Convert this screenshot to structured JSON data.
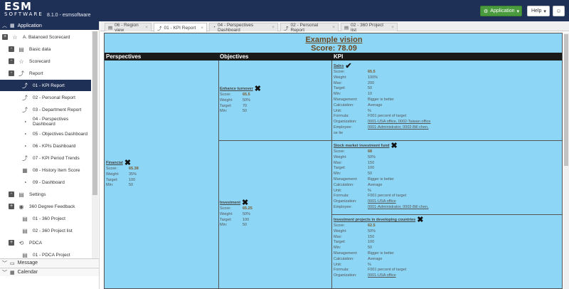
{
  "app": {
    "logo_main": "ESM",
    "logo_sub": "SOFTWARE",
    "version": "8.1.0 - esmsoftware"
  },
  "header": {
    "application_label": "Application",
    "help_label": "Help",
    "user_icon": "user-icon",
    "accent": "#4a9b3e",
    "bar_color": "#1f3057"
  },
  "sidebar": {
    "title": "Application",
    "items": [
      {
        "label": "A. Balanced Scorecard",
        "icon": "star-icon",
        "toggle": "+"
      },
      {
        "label": "Basic data",
        "icon": "document-icon",
        "toggle": "-"
      },
      {
        "label": "Scorecard",
        "icon": "star-icon",
        "toggle": "-"
      },
      {
        "label": "Report",
        "icon": "trend-icon",
        "toggle": "-"
      },
      {
        "label": "01 - KPI Report",
        "icon": "trend-icon",
        "active": true
      },
      {
        "label": "02 - Personal Report",
        "icon": "trend-icon"
      },
      {
        "label": "03 - Department Report",
        "icon": "trend-icon"
      },
      {
        "label": "04 - Perspectives Dashboard",
        "icon": "pie-icon"
      },
      {
        "label": "05 - Objectives Dashboard",
        "icon": "pie-icon"
      },
      {
        "label": "06 - KPIs Dashboard",
        "icon": "pie-icon"
      },
      {
        "label": "07 - KPI Period Trends",
        "icon": "trend-icon"
      },
      {
        "label": "08 - History Item Score",
        "icon": "calendar-icon"
      },
      {
        "label": "09 - Dashboard",
        "icon": "pie-icon"
      },
      {
        "label": "Settings",
        "icon": "document-icon",
        "toggle": "-"
      },
      {
        "label": "360 Degree Feedback",
        "icon": "circle-icon",
        "toggle": "+"
      },
      {
        "label": "01 - 360 Project",
        "icon": "document-icon"
      },
      {
        "label": "02 - 360 Project list",
        "icon": "document-icon"
      },
      {
        "label": "PDCA",
        "icon": "cycle-icon",
        "toggle": "+"
      },
      {
        "label": "01 - PDCA Project",
        "icon": "document-icon"
      }
    ],
    "accordions": [
      {
        "label": "Message"
      },
      {
        "label": "Calendar"
      }
    ]
  },
  "tabs": [
    {
      "label": "06 - Region view"
    },
    {
      "label": "01 - KPI Report",
      "active": true
    },
    {
      "label": "04 - Perspectives Dashboard"
    },
    {
      "label": "02 - Personal Report"
    },
    {
      "label": "02 - 360 Project list"
    }
  ],
  "report": {
    "vision_title": "Example vision",
    "vision_score": "Score: 78.09",
    "headers": {
      "perspectives": "Perspectives",
      "objectives": "Objectives",
      "kpi": "KPI"
    },
    "bg_color": "#8ed6f6",
    "perspective": {
      "name": "Financial",
      "mark": "✖",
      "fields": [
        {
          "k": "Score:",
          "v": "65.38",
          "bold": true
        },
        {
          "k": "Weight:",
          "v": "35%"
        },
        {
          "k": "Target:",
          "v": "100"
        },
        {
          "k": "Min:",
          "v": "50"
        }
      ]
    },
    "objectives": [
      {
        "name": "Enhance turnover",
        "mark": "✖",
        "fields": [
          {
            "k": "Score:",
            "v": "65.5",
            "bold": true
          },
          {
            "k": "Weight:",
            "v": "50%"
          },
          {
            "k": "Target:",
            "v": "70"
          },
          {
            "k": "Min:",
            "v": "50"
          }
        ]
      },
      {
        "name": "Investment",
        "mark": "✖",
        "fields": [
          {
            "k": "Score:",
            "v": "65.25",
            "bold": true
          },
          {
            "k": "Weight:",
            "v": "50%"
          },
          {
            "k": "Target:",
            "v": "100"
          },
          {
            "k": "Min:",
            "v": "50"
          }
        ]
      }
    ],
    "kpis": [
      {
        "name": "Sales",
        "mark": "✔",
        "fields": [
          {
            "k": "Score:",
            "v": "65.5",
            "bold": true
          },
          {
            "k": "Weight:",
            "v": "100%"
          },
          {
            "k": "Max:",
            "v": "200"
          },
          {
            "k": "Target:",
            "v": "50"
          },
          {
            "k": "Min:",
            "v": "10"
          },
          {
            "k": "Management:",
            "v": "Bigger is better"
          },
          {
            "k": "Calculation:",
            "v": "Average"
          },
          {
            "k": "Unit:",
            "v": "%"
          },
          {
            "k": "Formula:",
            "v": "F001 percent of target"
          },
          {
            "k": "Organization:",
            "v": "0001-USA office,  0002-Taiwan office",
            "link": true
          },
          {
            "k": "Employee:",
            "v": "0001-Administrator,  0002-Bill chen,",
            "link": true
          }
        ],
        "extra": "se tie"
      },
      {
        "name": "Stock market investment fund",
        "mark": "✖",
        "fields": [
          {
            "k": "Score:",
            "v": "68",
            "bold": true
          },
          {
            "k": "Weight:",
            "v": "50%"
          },
          {
            "k": "Max:",
            "v": "150"
          },
          {
            "k": "Target:",
            "v": "100"
          },
          {
            "k": "Min:",
            "v": "50"
          },
          {
            "k": "Management:",
            "v": "Bigger is better"
          },
          {
            "k": "Calculation:",
            "v": "Average"
          },
          {
            "k": "Unit:",
            "v": "%"
          },
          {
            "k": "Formula:",
            "v": "F001 percent of target"
          },
          {
            "k": "Organization:",
            "v": "0001-USA office",
            "link": true
          },
          {
            "k": "Employee:",
            "v": "0001-Administrator,  0002-Bill chen,",
            "link": true
          }
        ]
      },
      {
        "name": "Investment projects in developing countries",
        "mark": "✖",
        "fields": [
          {
            "k": "Score:",
            "v": "62.5",
            "bold": true
          },
          {
            "k": "Weight:",
            "v": "50%"
          },
          {
            "k": "Max:",
            "v": "150"
          },
          {
            "k": "Target:",
            "v": "100"
          },
          {
            "k": "Min:",
            "v": "50"
          },
          {
            "k": "Management:",
            "v": "Bigger is better"
          },
          {
            "k": "Calculation:",
            "v": "Average"
          },
          {
            "k": "Unit:",
            "v": "%"
          },
          {
            "k": "Formula:",
            "v": "F001 percent of target"
          },
          {
            "k": "Organization:",
            "v": "0001-USA office",
            "link": true
          }
        ]
      }
    ]
  }
}
